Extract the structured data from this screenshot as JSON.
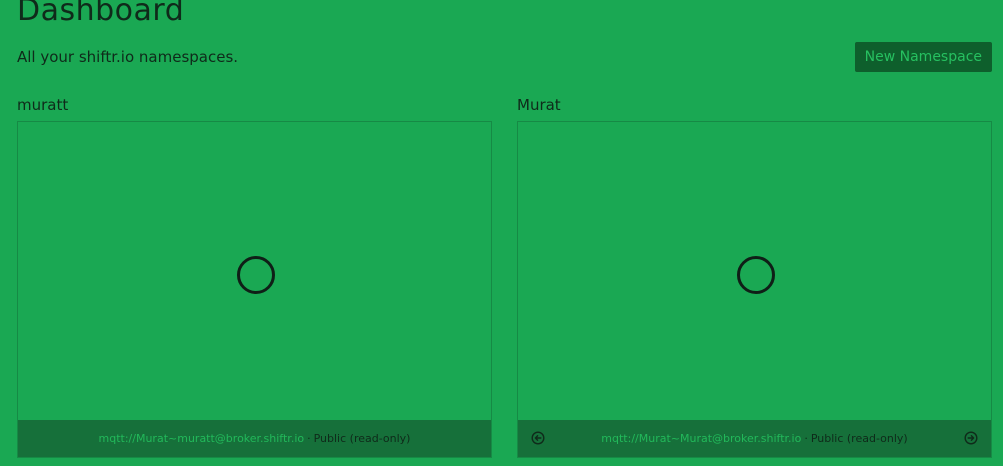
{
  "header": {
    "title": "Dashboard",
    "subtitle": "All your shiftr.io namespaces.",
    "new_namespace_label": "New Namespace"
  },
  "namespaces": [
    {
      "name": "muratt",
      "url": "mqtt://Murat~muratt@broker.shiftr.io",
      "separator": "·",
      "visibility": "Public (read-only)",
      "loading_icon": "spinner-circle-icon"
    },
    {
      "name": "Murat",
      "url": "mqtt://Murat~Murat@broker.shiftr.io",
      "separator": "·",
      "visibility": "Public (read-only)",
      "loading_icon": "spinner-circle-icon",
      "prev_icon": "arrow-left-circle-icon",
      "next_icon": "arrow-right-circle-icon"
    }
  ],
  "colors": {
    "background": "#1aa853",
    "button_bg": "#0e5f2c",
    "button_text": "#26c060",
    "footer_bg": "#16703a",
    "link": "#22b85a",
    "text": "#0f2a1a"
  }
}
